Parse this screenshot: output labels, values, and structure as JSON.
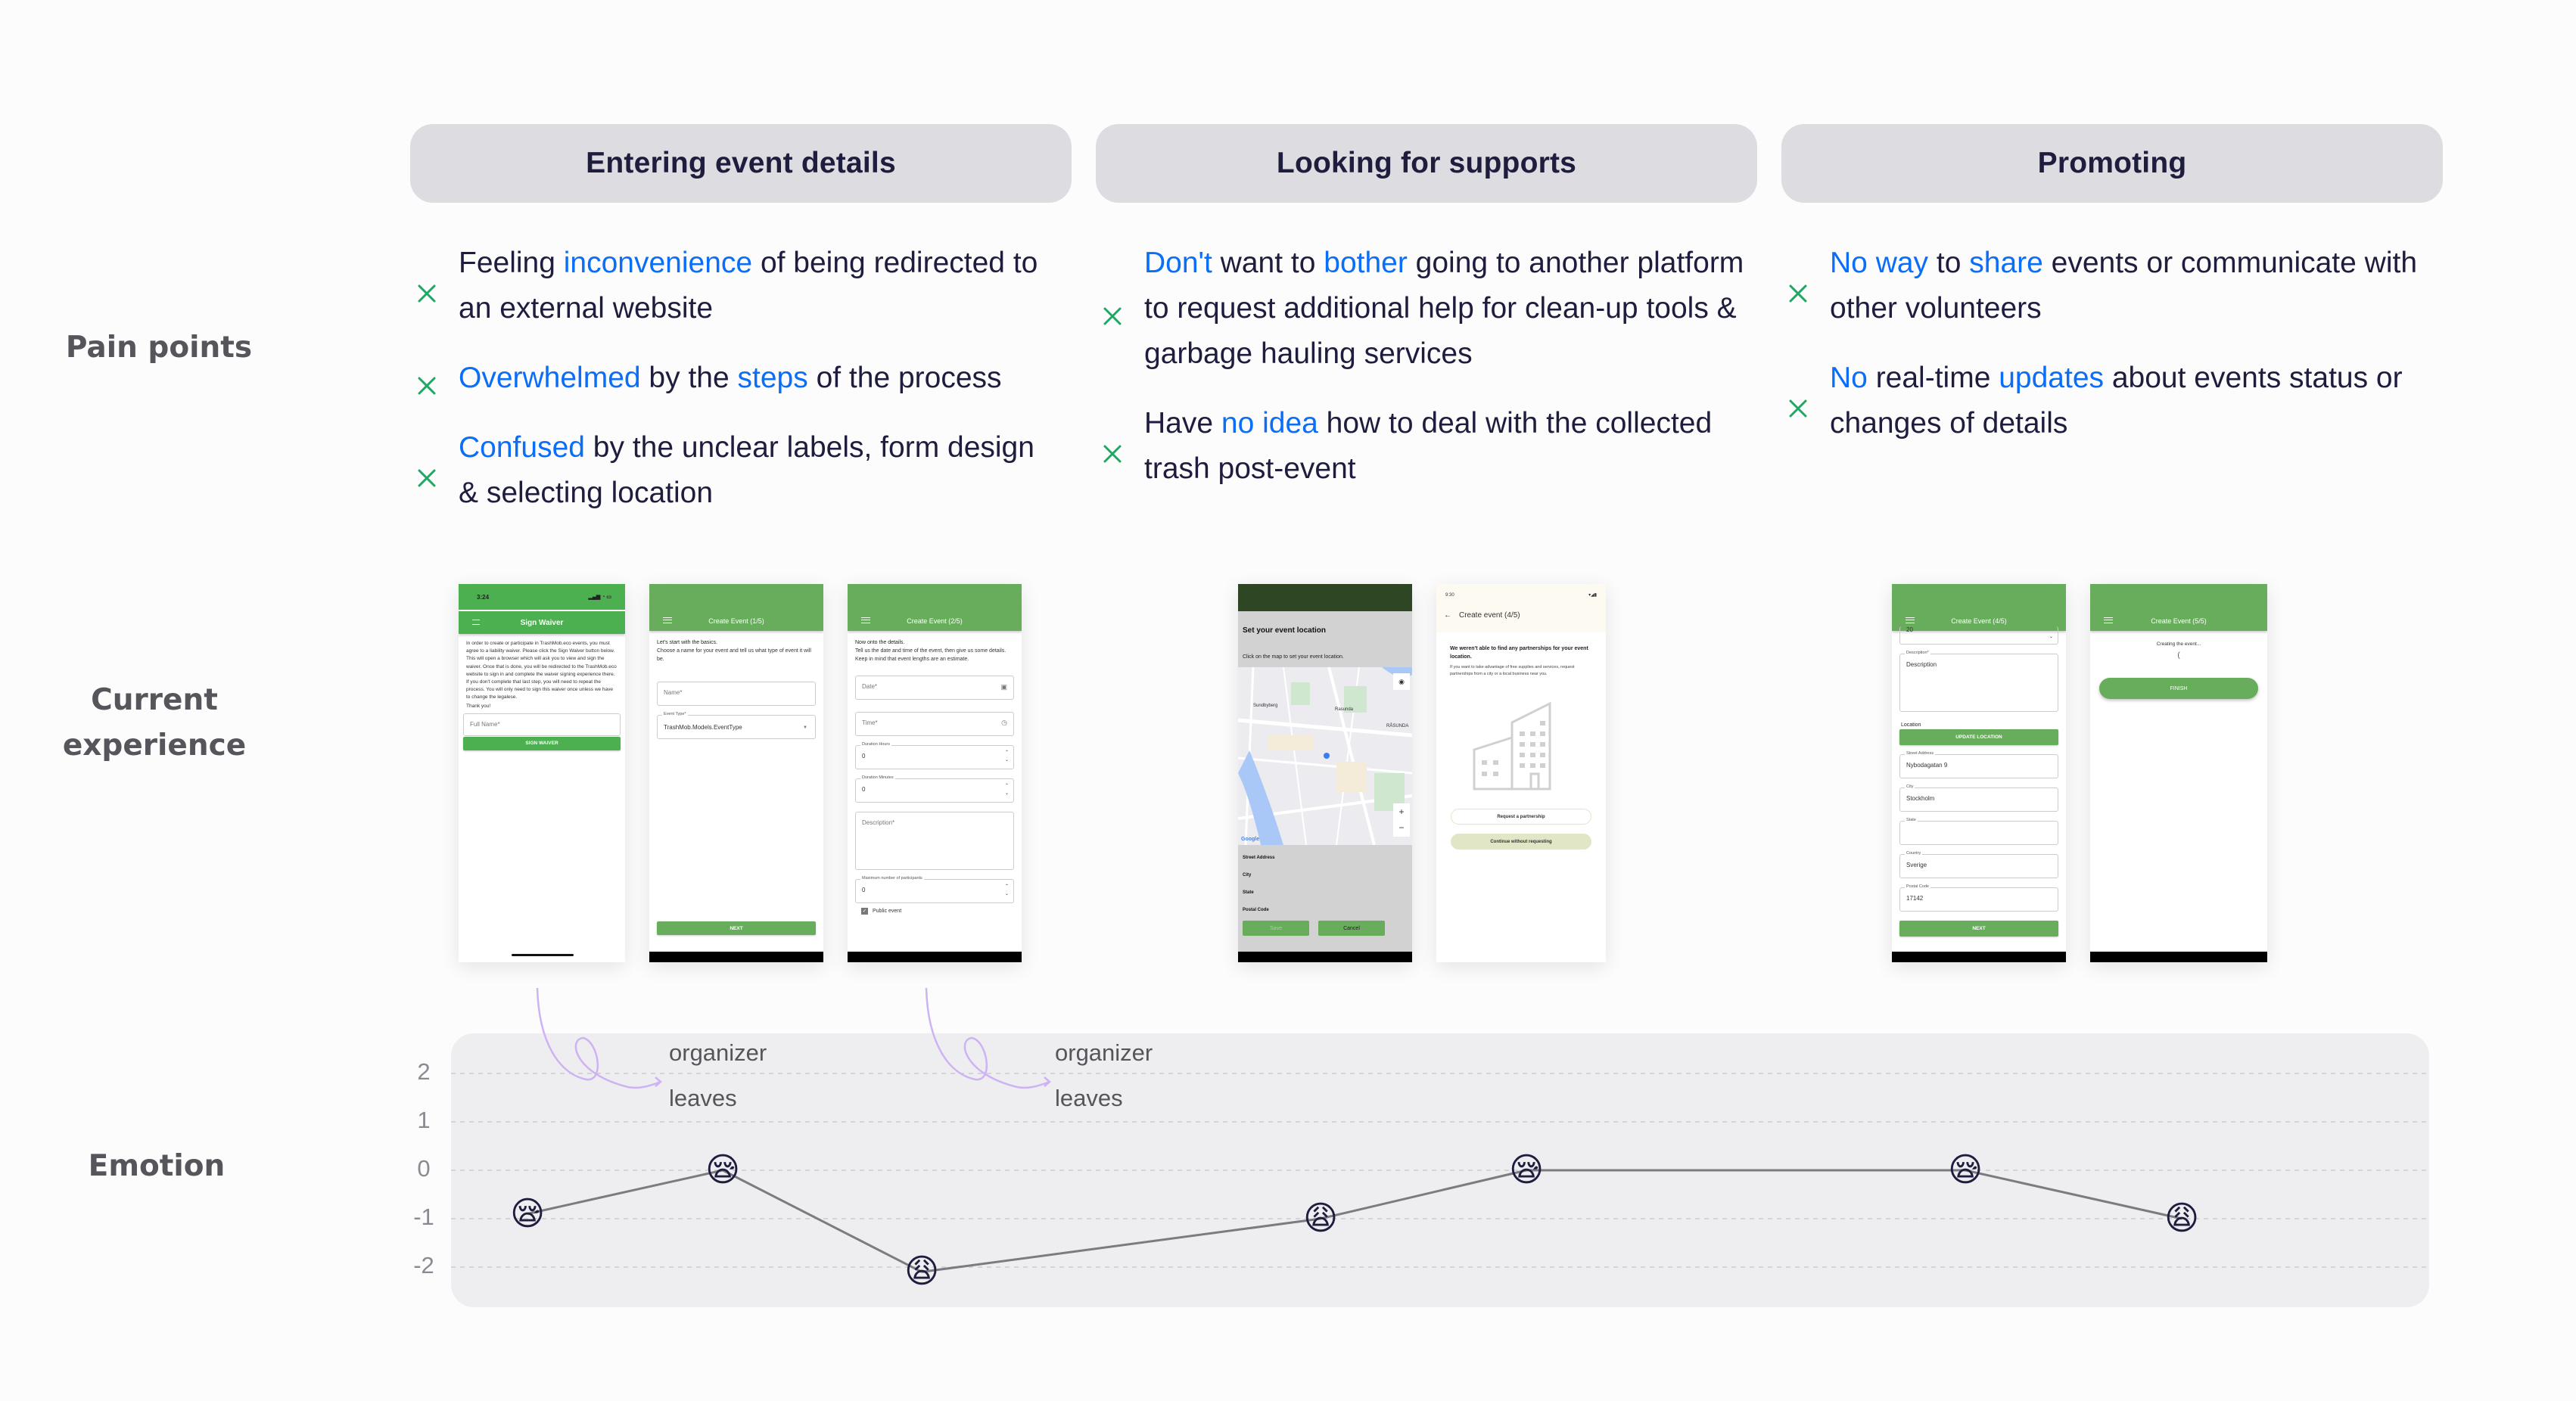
{
  "row_labels": {
    "pain_points": "Pain points",
    "current_experience_line1": "Current",
    "current_experience_line2": "experience",
    "emotion": "Emotion"
  },
  "colors": {
    "highlight": "#0a6ef6",
    "x_mark": "#1fa864",
    "header_bg": "#dddce1",
    "chart_bg": "#eeeef1",
    "annotation_arrow": "#cdb3f2",
    "app_green": "#67ad5b"
  },
  "stages": [
    {
      "title": "Entering event details",
      "pain_points": [
        [
          {
            "t": "Feeling "
          },
          {
            "t": "inconvenience",
            "h": true
          },
          {
            "t": " of being redirected to an external website"
          }
        ],
        [
          {
            "t": "Overwhelmed",
            "h": true
          },
          {
            "t": " by the "
          },
          {
            "t": "steps",
            "h": true
          },
          {
            "t": " of the process"
          }
        ],
        [
          {
            "t": "Confused",
            "h": true
          },
          {
            "t": " by the unclear labels, form design & selecting location"
          }
        ]
      ]
    },
    {
      "title": "Looking for supports",
      "pain_points": [
        [
          {
            "t": "Don't",
            "h": true
          },
          {
            "t": " want to "
          },
          {
            "t": "bother",
            "h": true
          },
          {
            "t": " going to another platform to request additional help for clean-up tools & garbage hauling services"
          }
        ],
        [
          {
            "t": "Have "
          },
          {
            "t": "no idea",
            "h": true
          },
          {
            "t": " how to deal with the collected trash post-event"
          }
        ]
      ]
    },
    {
      "title": "Promoting",
      "pain_points": [
        [
          {
            "t": "No way",
            "h": true
          },
          {
            "t": " to "
          },
          {
            "t": "share",
            "h": true
          },
          {
            "t": " events or communicate with other volunteers"
          }
        ],
        [
          {
            "t": "No",
            "h": true
          },
          {
            "t": " real-time "
          },
          {
            "t": "updates",
            "h": true
          },
          {
            "t": " about events status or changes of details"
          }
        ]
      ]
    }
  ],
  "screens": {
    "sign_waiver": {
      "status_time": "3:24",
      "title": "Sign Waiver",
      "body": "In order to create or participate in TrashMob.eco events, you must agree to a liability waiver. Please click the Sign Waiver button below. This will open a browser which will ask you to view and sign the waiver. Once that is done, you will be redirected to the TrashMob.eco website to sign in and complete the waiver signing experience there. If you don't complete that last step, you will need to repeat the process. You will only need to sign this waiver once unless we have to change the legalese.",
      "thanks": "Thank you!",
      "name_placeholder": "Full Name*",
      "button": "SIGN WAIVER"
    },
    "create_1": {
      "title": "Create Event (1/5)",
      "heading": "Let's start with the basics.",
      "body": "Choose a name for your event and tell us what type of event it will be.",
      "name_placeholder": "Name*",
      "type_label": "Event Type*",
      "type_value": "TrashMob.Models.EventType",
      "button": "NEXT"
    },
    "create_2": {
      "title": "Create Event (2/5)",
      "heading": "Now onto the details.",
      "body": "Tell us the date and time of the event, then give us some details. Keep in mind that event lengths are an estimate.",
      "date_placeholder": "Date*",
      "time_placeholder": "Time*",
      "hours_label": "Duration Hours",
      "hours_value": "0",
      "minutes_label": "Duration Minutes",
      "minutes_value": "0",
      "description_placeholder": "Description*",
      "max_label": "Maximum number of participants",
      "max_value": "0",
      "public_label": "Public event"
    },
    "location": {
      "title": "Set your event location",
      "instructions": "Click on the map to set your event location.",
      "map_labels": [
        "Sundbyberg",
        "Rasunda",
        "RÅSUNDA"
      ],
      "map_brand": "Google",
      "fields": [
        "Street Address",
        "City",
        "State",
        "Postal Code"
      ],
      "save": "Save",
      "cancel": "Cancel"
    },
    "partnership": {
      "status_time": "9:30",
      "title": "Create event (4/5)",
      "heading": "We weren't able to find any partnerships for your event location.",
      "body": "If you want to take advantage of free supplies and services, request partnerships from a city or a local business near you.",
      "request_button": "Request a partnership",
      "continue_button": "Continue without requesting"
    },
    "create_4": {
      "title": "Create Event (4/5)",
      "partial_value": "20",
      "description_label": "Description*",
      "description_value": "Description",
      "location_label": "Location",
      "update_button": "UPDATE LOCATION",
      "street_label": "Street Address",
      "street_value": "Nybodagatan 9",
      "city_label": "City",
      "city_value": "Stockholm",
      "state_label": "State",
      "state_value": "",
      "country_label": "Country",
      "country_value": "Sverige",
      "postal_label": "Postal Code",
      "postal_value": "17142",
      "button": "NEXT"
    },
    "create_5": {
      "title": "Create Event (5/5)",
      "status": "Creating the event...",
      "spinner": "(",
      "button": "FINISH"
    }
  },
  "annotations": [
    {
      "line1": "organizer",
      "line2": "leaves"
    },
    {
      "line1": "organizer",
      "line2": "leaves"
    }
  ],
  "chart_data": {
    "type": "line",
    "title": "Emotion",
    "xlabel": "",
    "ylabel": "",
    "ylim": [
      -2,
      2
    ],
    "yticks": [
      "2",
      "1",
      "0",
      "-1",
      "-2"
    ],
    "grid": true,
    "points": [
      {
        "step": 1,
        "stage": "Entering event details",
        "value": -0.9,
        "emoji": "😪",
        "emoji_name": "sleepy-face"
      },
      {
        "step": 2,
        "stage": "Entering event details",
        "value": 0,
        "emoji": "😪",
        "emoji_name": "sleepy-face"
      },
      {
        "step": 3,
        "stage": "Entering event details",
        "value": -2.1,
        "emoji": "😩",
        "emoji_name": "weary-face"
      },
      {
        "step": 4,
        "stage": "Looking for supports",
        "value": -1,
        "emoji": "😩",
        "emoji_name": "weary-face"
      },
      {
        "step": 5,
        "stage": "Looking for supports",
        "value": 0,
        "emoji": "😪",
        "emoji_name": "sleepy-face"
      },
      {
        "step": 6,
        "stage": "Promoting",
        "value": 0,
        "emoji": "😪",
        "emoji_name": "sleepy-face"
      },
      {
        "step": 7,
        "stage": "Promoting",
        "value": -1,
        "emoji": "😩",
        "emoji_name": "weary-face"
      }
    ]
  }
}
